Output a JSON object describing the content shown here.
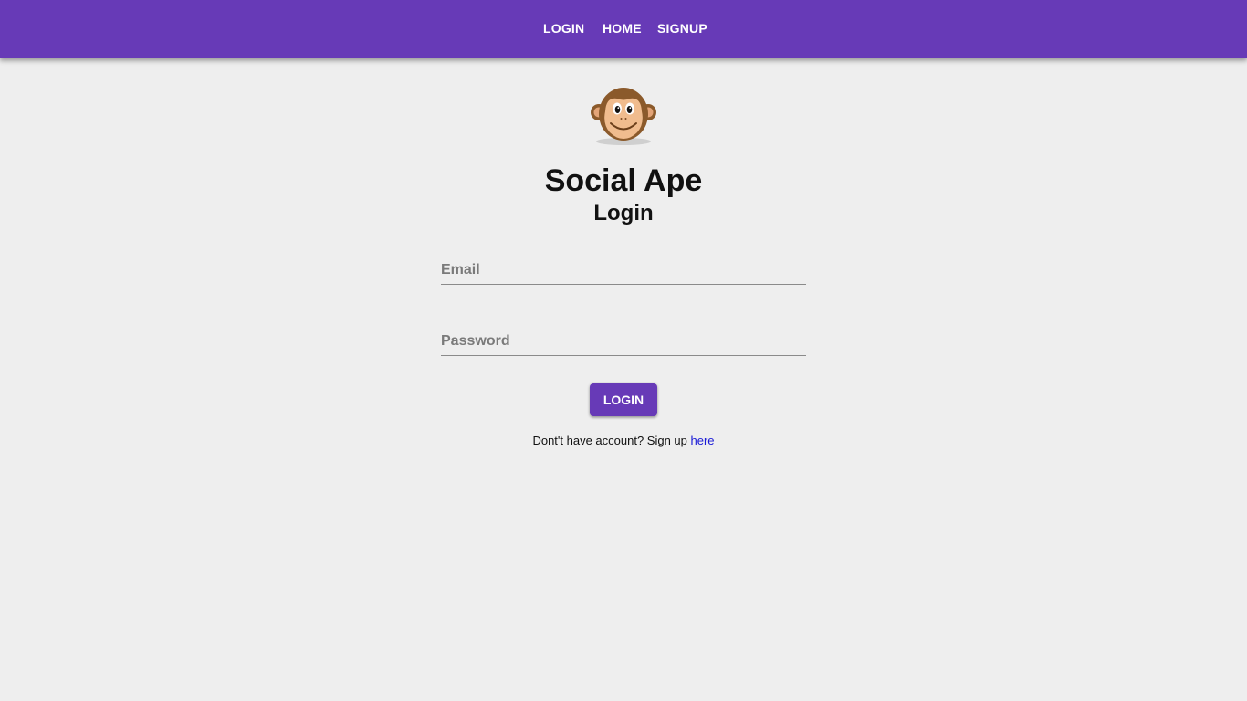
{
  "navbar": {
    "links": [
      {
        "label": "LOGIN"
      },
      {
        "label": "HOME"
      },
      {
        "label": "SIGNUP"
      }
    ],
    "background_color": "#673ab7"
  },
  "logo": {
    "icon": "monkey-face-icon"
  },
  "page": {
    "title": "Social Ape",
    "subtitle": "Login"
  },
  "form": {
    "email": {
      "placeholder": "Email",
      "value": ""
    },
    "password": {
      "placeholder": "Password",
      "value": ""
    },
    "submit_label": "LOGIN"
  },
  "signup_prompt": {
    "text": "Dont't have account? Sign up ",
    "link_label": "here"
  },
  "colors": {
    "accent": "#673ab7",
    "link": "#1a1ad6",
    "background": "#eeeeee"
  }
}
